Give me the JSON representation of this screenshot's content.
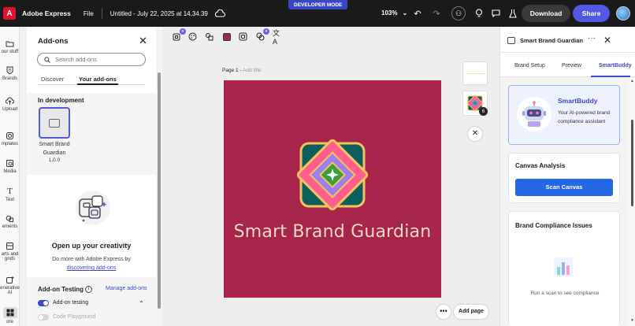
{
  "topbar": {
    "logo_glyph": "A",
    "app_name": "Adobe Express",
    "file_menu": "File",
    "doc_title": "Untitled - July 22, 2025 at 14.34.39",
    "dev_mode": "DEVELOPER MODE",
    "zoom": "103%",
    "download": "Download",
    "share": "Share"
  },
  "rail": {
    "items": [
      {
        "label": "our stuff",
        "icon": "folder-icon"
      },
      {
        "label": "Brands",
        "icon": "brand-icon"
      },
      {
        "label": "Upload",
        "icon": "upload-icon"
      },
      {
        "label": "mplates",
        "icon": "templates-icon"
      },
      {
        "label": "Media",
        "icon": "media-icon"
      },
      {
        "label": "Text",
        "icon": "text-icon"
      },
      {
        "label": "ements",
        "icon": "elements-icon"
      },
      {
        "label": "arts and",
        "label2": "grids",
        "icon": "charts-icon"
      },
      {
        "label": "enerative",
        "label2": "AI",
        "icon": "generative-ai-icon"
      },
      {
        "label": "",
        "icon": "addons-icon"
      },
      {
        "label": "ore",
        "icon": "more-icon"
      }
    ]
  },
  "addons": {
    "title": "Add-ons",
    "search_placeholder": "Search add-ons",
    "tabs": [
      "Discover",
      "Your add-ons"
    ],
    "in_development": "In development",
    "addon_name_1": "Smart Brand",
    "addon_name_2": "Guardian",
    "addon_version": "1.0.0",
    "promo_title": "Open up your creativity",
    "promo_text": "Do more with Adobe Express by",
    "promo_link": "discovering add-ons",
    "testing_title": "Add-on Testing",
    "manage": "Manage add-ons",
    "toggle_testing": "Add-on testing",
    "toggle_playground": "Code Playground"
  },
  "canvas": {
    "page_label": "Page 1 - ",
    "add_title": "Add title",
    "design_title": "Smart Brand Guardian",
    "thumb_count": "6",
    "more": "•••",
    "add_page": "Add page"
  },
  "right": {
    "title": "Smart Brand Guardian",
    "tabs": [
      "Brand Setup",
      "Preview",
      "SmartBuddy"
    ],
    "smartbuddy_name": "SmartBuddy",
    "smartbuddy_desc": "Your AI-powered brand compliance assistant",
    "canvas_analysis": "Canvas Analysis",
    "scan_button": "Scan Canvas",
    "compliance_title": "Brand Compliance Issues",
    "compliance_text": "Run a scan to see compliance"
  },
  "colors": {
    "accent": "#5258e4",
    "link": "#3a47d5",
    "scan_button": "#2468e6",
    "design_bg": "#a7244b",
    "design_text": "#f4d9c4"
  }
}
